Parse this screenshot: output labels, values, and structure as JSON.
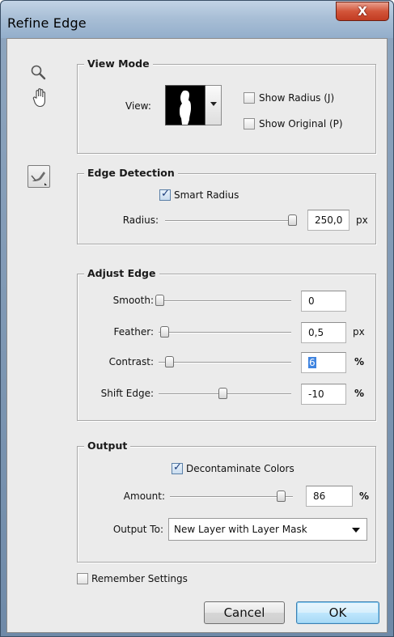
{
  "window": {
    "title": "Refine Edge",
    "close_label": "X"
  },
  "tools": [
    {
      "name": "zoom-tool",
      "icon": "magnifier-icon"
    },
    {
      "name": "hand-tool",
      "icon": "hand-icon"
    },
    {
      "name": "refine-radius-tool",
      "icon": "brush-icon"
    }
  ],
  "view_mode": {
    "title": "View Mode",
    "view_label": "View:",
    "show_radius_label": "Show Radius (J)",
    "show_radius_checked": false,
    "show_original_label": "Show Original (P)",
    "show_original_checked": false
  },
  "edge_detection": {
    "title": "Edge Detection",
    "smart_radius_label": "Smart Radius",
    "smart_radius_checked": true,
    "radius_label": "Radius:",
    "radius_value": "250,0",
    "radius_unit": "px",
    "radius_slider_fraction": 1.0
  },
  "adjust_edge": {
    "title": "Adjust Edge",
    "smooth_label": "Smooth:",
    "smooth_value": "0",
    "feather_label": "Feather:",
    "feather_value": "0,5",
    "feather_unit": "px",
    "contrast_label": "Contrast:",
    "contrast_value": "6",
    "contrast_unit": "%",
    "shift_edge_label": "Shift Edge:",
    "shift_edge_value": "-10",
    "shift_edge_unit": "%"
  },
  "output": {
    "title": "Output",
    "decontaminate_label": "Decontaminate Colors",
    "decontaminate_checked": true,
    "amount_label": "Amount:",
    "amount_value": "86",
    "amount_unit": "%",
    "output_to_label": "Output To:",
    "output_to_value": "New Layer with Layer Mask"
  },
  "remember_settings_label": "Remember Settings",
  "remember_settings_checked": false,
  "buttons": {
    "cancel_label": "Cancel",
    "ok_label": "OK"
  },
  "colors": {
    "title_bar": "#a9bfd6",
    "close_button": "#d2553a",
    "dialog_background": "#ebebeb",
    "ok_button": "#bee6fd",
    "selection": "#3f84e0"
  }
}
